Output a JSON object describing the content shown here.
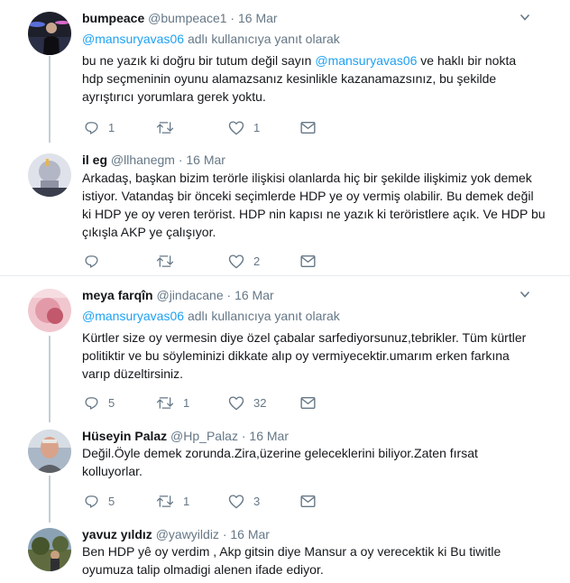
{
  "tweets": [
    {
      "name": "bumpeace",
      "handle": "@bumpeace1",
      "date": "16 Mar",
      "reply_prefix": "@mansuryavas06",
      "reply_suffix": "adlı kullanıcıya yanıt olarak",
      "text_lines": [
        [
          "bu ne yazık ki doğru bir tutum değil sayın ",
          "@mansuryavas06",
          "  ve haklı bir nokta"
        ],
        [
          "hdp seçmeninin oyunu alamazsanız kesinlikle kazanamazsınız, bu şekilde"
        ],
        [
          "ayrıştırıcı yorumlara gerek yoktu."
        ]
      ],
      "replies": "1",
      "retweets": "",
      "likes": "1",
      "avatar": "avatar-person-dark"
    },
    {
      "name": "il eg",
      "handle": "@llhanegm",
      "date": "16 Mar",
      "text_lines": [
        "Arkadaş, başkan bizim terörle ilişkisi olanlarda hiç bir şekilde ilişkimiz yok demek",
        "istiyor. Vatandaş bir önceki seçimlerde HDP ye oy vermiş olabilir. Bu demek değil",
        "ki HDP ye oy veren terörist. HDP nin kapısı ne yazık ki teröristlere açık. Ve HDP bu",
        "çıkışla AKP ye çalışıyor."
      ],
      "replies": "",
      "retweets": "",
      "likes": "2",
      "avatar": "avatar-statue"
    },
    {
      "name": "meya farqîn",
      "handle": "@jindacane",
      "date": "16 Mar",
      "reply_prefix": "@mansuryavas06",
      "reply_suffix": "adlı kullanıcıya yanıt olarak",
      "text_lines": [
        "Kürtler size oy vermesin diye özel çabalar sarfediyorsunuz,tebrikler. Tüm kürtler",
        "politiktir ve bu söyleminizi dikkate alıp oy vermiyecektir.umarım erken farkına",
        "varıp düzeltirsiniz."
      ],
      "replies": "5",
      "retweets": "1",
      "likes": "32",
      "avatar": "avatar-pink"
    },
    {
      "name": "Hüseyin Palaz",
      "handle": "@Hp_Palaz",
      "date": "16 Mar",
      "text_lines": [
        "Değil.Öyle demek zorunda.Zira,üzerine geleceklerini  biliyor.Zaten fırsat",
        "kolluyorlar."
      ],
      "replies": "5",
      "retweets": "1",
      "likes": "3",
      "avatar": "avatar-man"
    },
    {
      "name": "yavuz yıldız",
      "handle": "@yawyildiz",
      "date": "16 Mar",
      "text_lines": [
        "Ben HDP yê oy verdim , Akp gitsin diye Mansur a oy verecektik ki Bu tiwitle",
        "oyumuza talip olmadigi alenen ifade ediyor."
      ],
      "avatar": "avatar-outdoor"
    }
  ],
  "dot": "·",
  "colors": {
    "text": "#14171a",
    "secondary": "#657786",
    "link": "#1da1f2",
    "border": "#e6ecf0",
    "thread_line": "#c4cfd6"
  }
}
